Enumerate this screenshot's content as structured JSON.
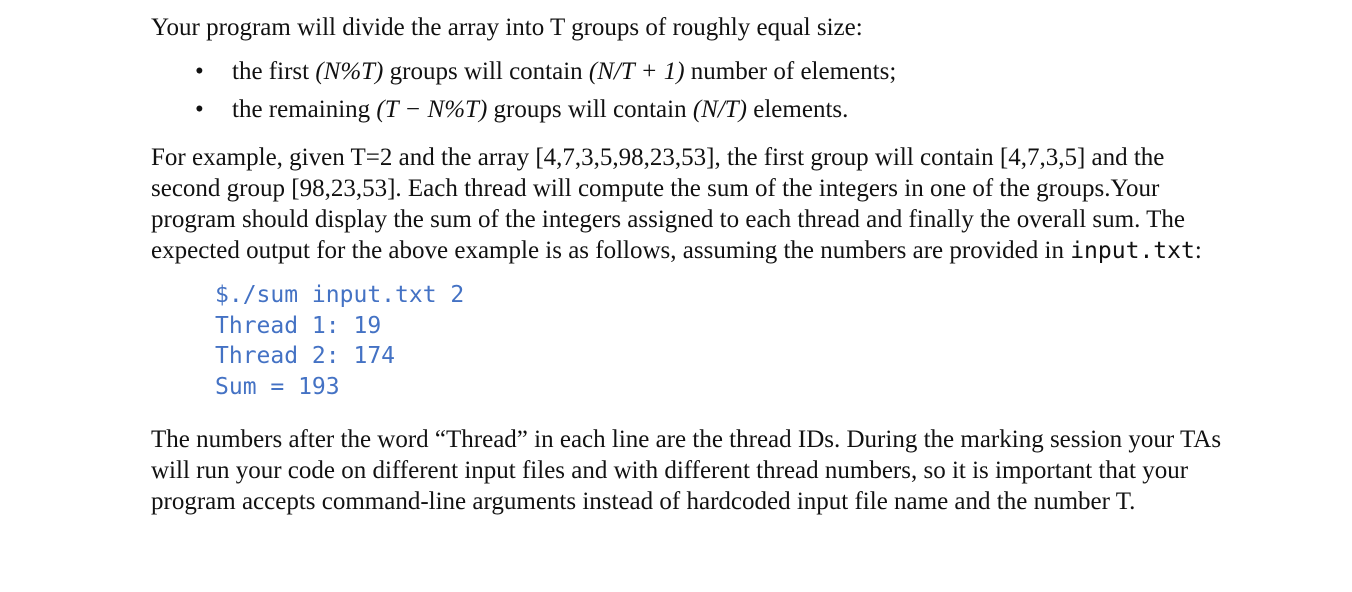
{
  "document": {
    "intro": "Your program will divide the array into T groups of roughly equal size:",
    "bullets": [
      {
        "pre": "the first ",
        "math": "(N%T)",
        "mid": " groups will contain ",
        "math2": "(N/T + 1)",
        "post": " number of elements;"
      },
      {
        "pre": "the remaining ",
        "math": "(T − N%T)",
        "mid": " groups will contain ",
        "math2": "(N/T)",
        "post": " elements."
      }
    ],
    "example_text": "For example, given T=2 and the array [4,7,3,5,98,23,53], the first group will contain [4,7,3,5] and the second group [98,23,53]. Each thread will compute the sum of the integers in one of the groups.Your program should display the sum of the integers assigned to each thread and finally the overall sum. The expected output for the above example is as follows, assuming the numbers are provided in ",
    "example_file": "input.txt",
    "example_end": ":",
    "code_lines": [
      "$./sum input.txt 2",
      "Thread 1: 19",
      "Thread 2: 174",
      "Sum = 193"
    ],
    "closing": "The numbers after the word “Thread” in each line are the thread IDs. During the marking session your TAs will run your code on different input files and with different thread numbers, so it is important that your program accepts command-line arguments instead of hardcoded input file name and the number T.",
    "bullet_symbol": "•",
    "code_color": "#4472c4"
  }
}
